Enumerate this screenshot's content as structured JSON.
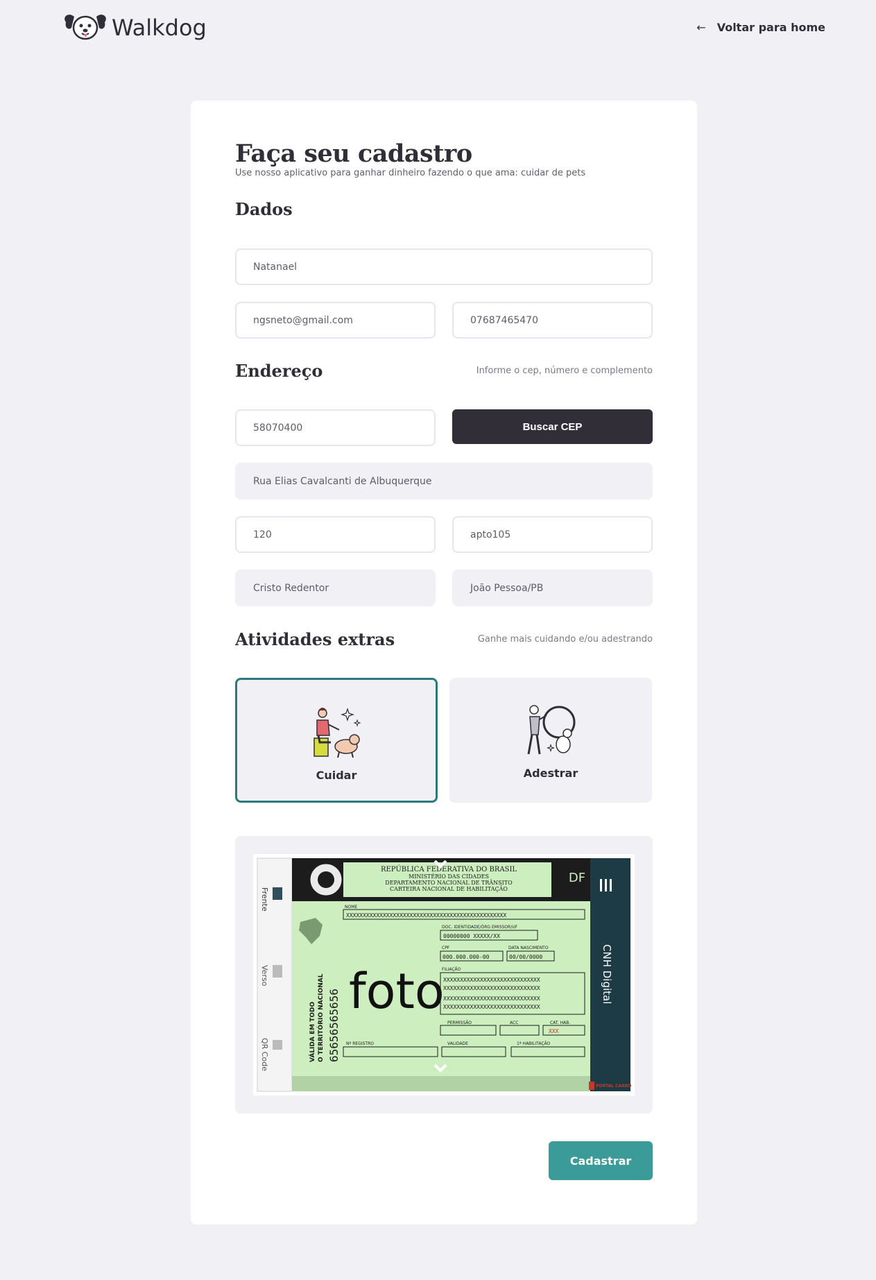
{
  "header": {
    "logo_text": "Walkdog",
    "back_label": "Voltar para home"
  },
  "form": {
    "title": "Faça seu cadastro",
    "subtitle": "Use nosso aplicativo para ganhar dinheiro fazendo o que ama: cuidar de pets",
    "dados": {
      "title": "Dados",
      "name": "Natanael",
      "email": "ngsneto@gmail.com",
      "cpf": "07687465470"
    },
    "endereco": {
      "title": "Endereço",
      "hint": "Informe o cep, número e complemento",
      "cep": "58070400",
      "search_button": "Buscar CEP",
      "street": "Rua Elias Cavalcanti de Albuquerque",
      "number": "120",
      "complement": "apto105",
      "district": "Cristo Redentor",
      "city": "João Pessoa/PB"
    },
    "atividades": {
      "title": "Atividades extras",
      "hint": "Ganhe mais cuidando e/ou adestrando",
      "options": [
        {
          "label": "Cuidar",
          "selected": true
        },
        {
          "label": "Adestrar",
          "selected": false
        }
      ]
    },
    "cnh": {
      "header_line1": "REPÚBLICA FEDERATIVA DO BRASIL",
      "header_line2": "MINISTÉRIO DAS CIDADES",
      "header_line3": "DEPARTAMENTO NACIONAL DE TRÂNSITO",
      "header_line4": "CARTEIRA NACIONAL DE HABILITAÇÃO",
      "uf": "DF",
      "photo_text": "foto",
      "side_title": "CNH Digital",
      "side_tab_front": "Frente",
      "side_tab_back": "Verso",
      "side_tab_qr": "QR Code",
      "vertical_text1": "VÁLIDA EM TODO",
      "vertical_text2": "O TERRITÓRIO NACIONAL",
      "number": "65656565656",
      "label_nome": "NOME",
      "value_nome": "XXXXXXXXXXXXXXXXXXXXXXXXXXXXXXXXXXXXXXXXXXXXXXXX",
      "label_doc": "DOC. IDENTIDADE/ÓRG EMISSOR/UF",
      "value_doc": "00000000  XXXXX/XX",
      "label_cpf": "CPF",
      "value_cpf": "000.000.000-00",
      "label_nasc": "DATA NASCIMENTO",
      "value_nasc": "00/00/0000",
      "label_filiacao": "FILIAÇÃO",
      "value_filiacao": "XXXXXXXXXXXXXXXXXXXXXXXXXXXXX",
      "label_permissao": "PERMISSÃO",
      "label_acc": "ACC",
      "label_cat": "CAT. HAB.",
      "value_cat": "XXX",
      "label_registro": "Nº REGISTRO",
      "label_validade": "VALIDADE",
      "label_habilitacao": "1ª HABILITAÇÃO",
      "watermark": "PORTAL CARRO"
    },
    "submit_label": "Cadastrar"
  },
  "colors": {
    "background": "#f0f0f5",
    "dark": "#312e38",
    "primary": "#3a9b98",
    "selected_border": "#2d7a7e"
  }
}
